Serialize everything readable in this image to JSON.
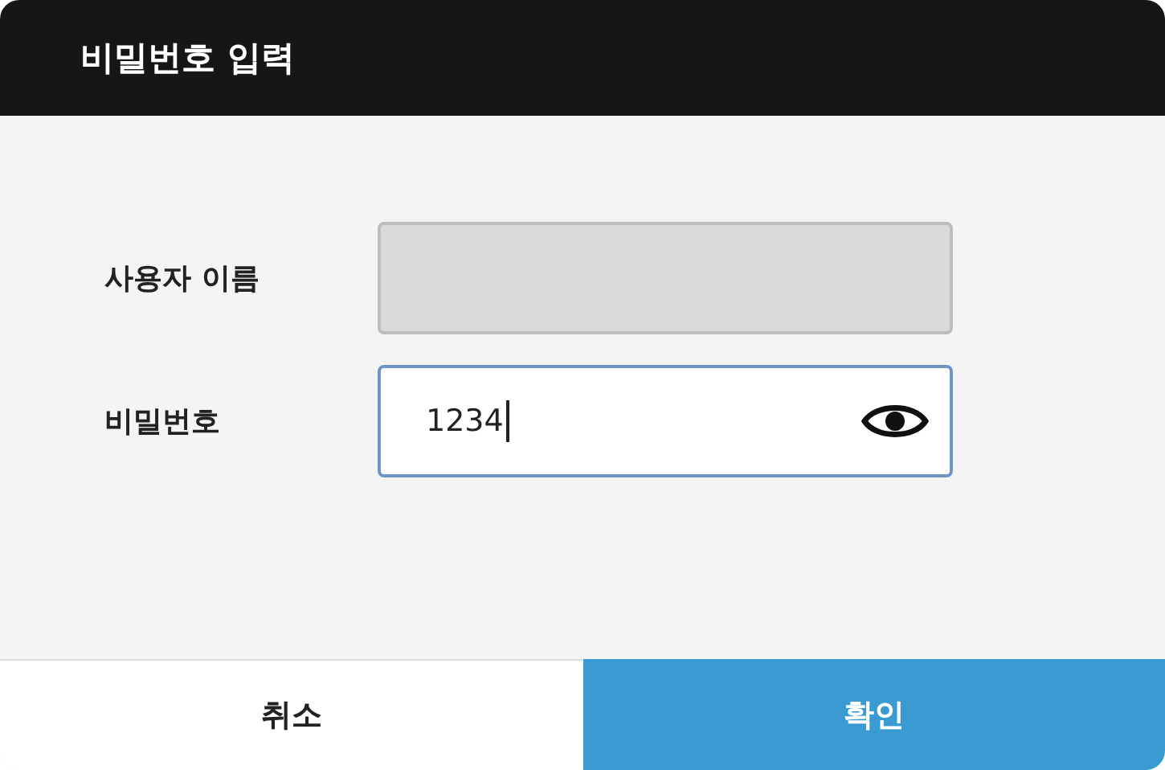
{
  "dialog": {
    "title": "비밀번호 입력"
  },
  "fields": [
    {
      "label": "사용자 이름",
      "disabled": true,
      "focused": false
    },
    {
      "label": "비밀번호",
      "value": "1234",
      "disabled": false,
      "focused": true,
      "reveal_toggle": true
    }
  ],
  "buttons": [
    {
      "label": "취소",
      "primary": false
    },
    {
      "label": "확인",
      "primary": true
    }
  ]
}
